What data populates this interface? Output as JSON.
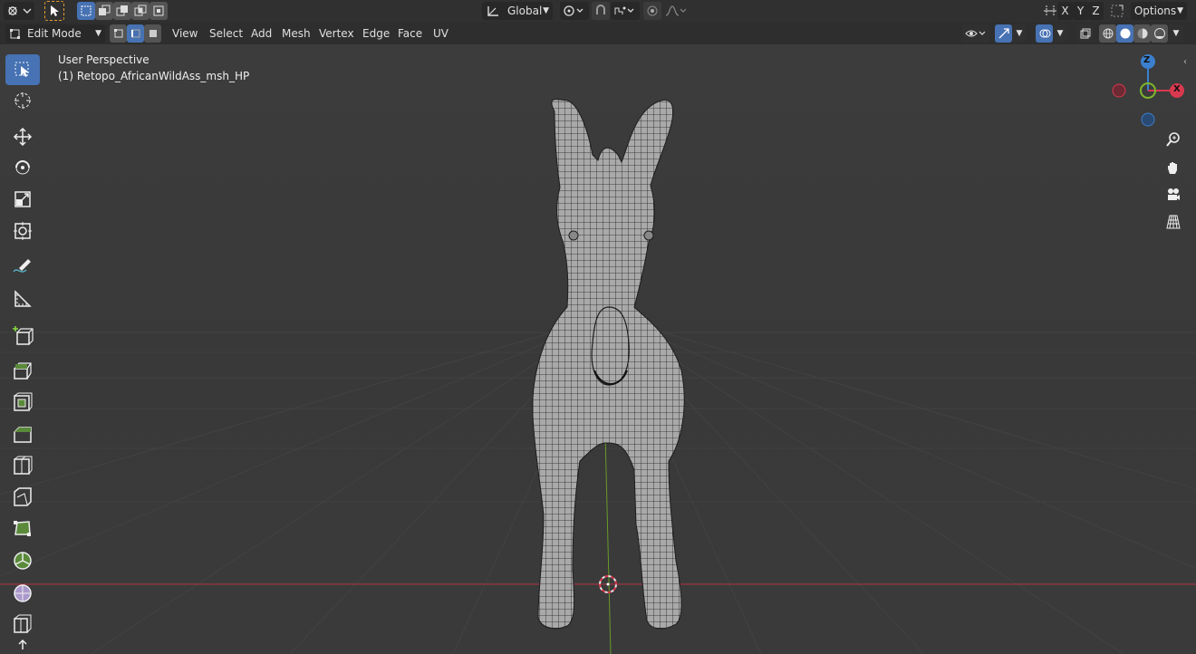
{
  "topbar": {
    "orientation": "Global",
    "axes": [
      "X",
      "Y",
      "Z"
    ],
    "options": "Options"
  },
  "header": {
    "mode": "Edit Mode",
    "menus": [
      "View",
      "Select",
      "Add",
      "Mesh",
      "Vertex",
      "Edge",
      "Face",
      "UV"
    ]
  },
  "viewport": {
    "view_name": "User Perspective",
    "object_name": "(1) Retopo_AfricanWildAss_msh_HP"
  },
  "gizmo": {
    "z_label": "Z",
    "x_label": "X"
  },
  "colors": {
    "accent": "#4772b3",
    "axis_x": "#d8394f",
    "axis_y": "#7eb82b",
    "axis_z": "#3b7fce",
    "grid_floor": "#3a3a3a"
  },
  "tools": [
    "select-box-icon",
    "cursor-icon",
    "move-icon",
    "rotate-icon",
    "scale-icon",
    "transform-icon",
    "annotate-icon",
    "measure-icon",
    "add-cube-icon",
    "extrude-icon",
    "inset-icon",
    "bevel-icon",
    "loop-cut-icon",
    "knife-icon",
    "poly-build-icon",
    "spin-icon",
    "smooth-icon",
    "edge-slide-icon"
  ]
}
